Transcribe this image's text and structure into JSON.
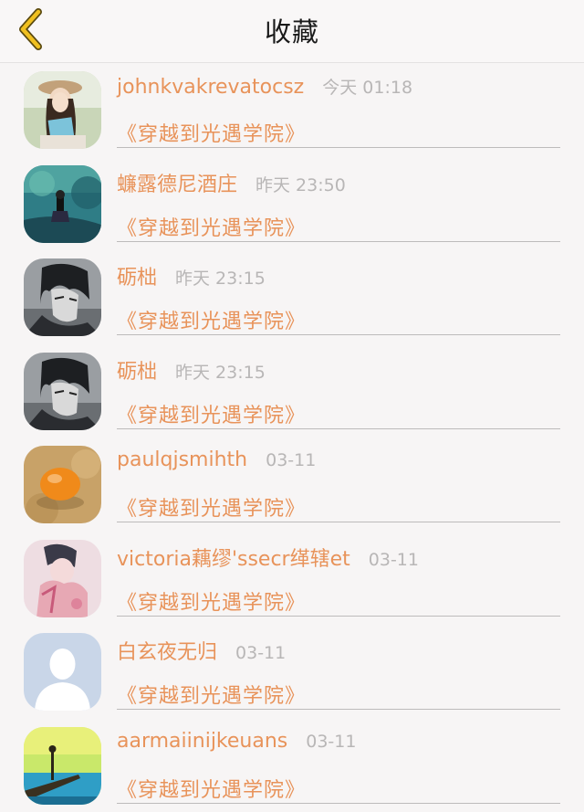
{
  "header": {
    "title": "收藏",
    "back_icon": "chevron-left-icon",
    "accent_color": "#e8b400"
  },
  "colors": {
    "username": "#e8935a",
    "time": "#b8b6b6"
  },
  "favorites": [
    {
      "username": "johnkvakrevatocsz",
      "time": "今天 01:18",
      "book": "《穿越到光遇学院》",
      "avatar": "girl-with-book-avatar"
    },
    {
      "username": "蠊露德尼酒庄",
      "time": "昨天 23:50",
      "book": "《穿越到光遇学院》",
      "avatar": "teal-scene-avatar"
    },
    {
      "username": "砺柮",
      "time": "昨天 23:15",
      "book": "《穿越到光遇学院》",
      "avatar": "anime-boy-avatar"
    },
    {
      "username": "砺柮",
      "time": "昨天 23:15",
      "book": "《穿越到光遇学院》",
      "avatar": "anime-boy-avatar"
    },
    {
      "username": "paulqjsmihth",
      "time": "03-11",
      "book": "《穿越到光遇学院》",
      "avatar": "egg-avatar"
    },
    {
      "username": "victoria藕缪'ssecr缂辖et",
      "time": "03-11",
      "book": "《穿越到光遇学院》",
      "avatar": "pink-figure-avatar"
    },
    {
      "username": "白玄夜无归",
      "time": "03-11",
      "book": "《穿越到光遇学院》",
      "avatar": "default-user-avatar"
    },
    {
      "username": "aarmaiinijkeuans",
      "time": "03-11",
      "book": "《穿越到光遇学院》",
      "avatar": "pier-sea-avatar"
    }
  ]
}
